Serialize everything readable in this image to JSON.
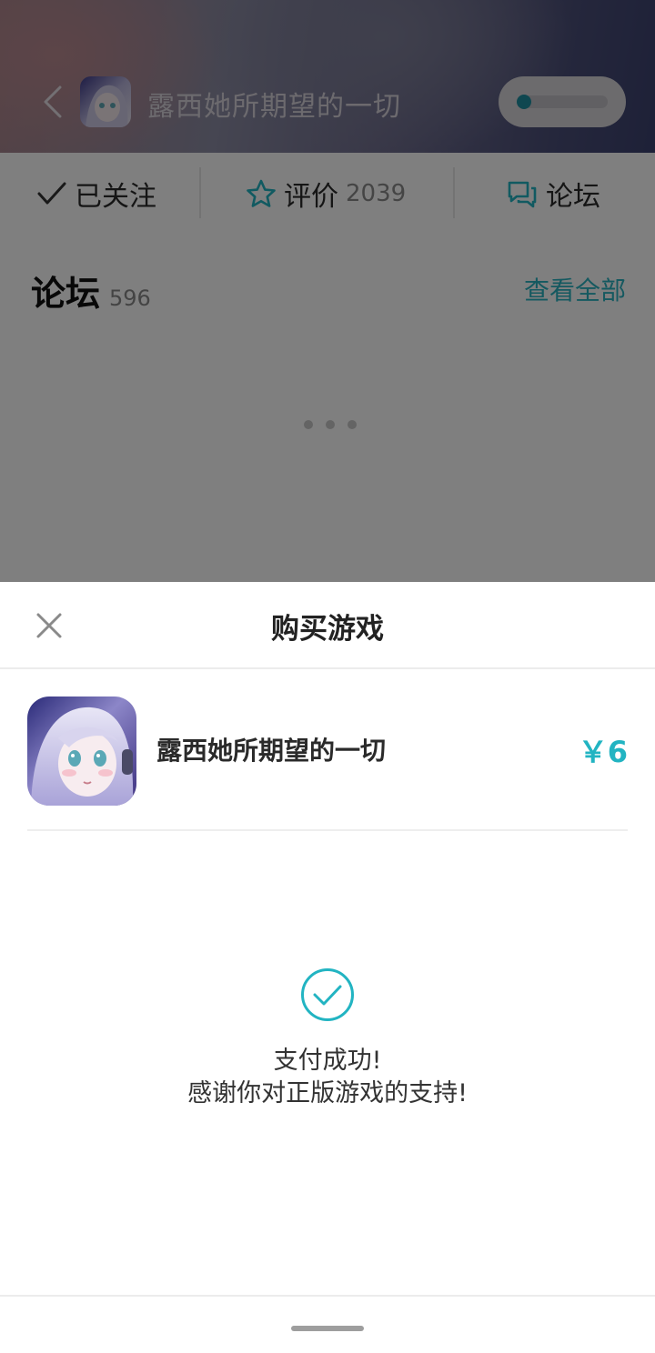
{
  "header": {
    "game_title": "露西她所期望的一切"
  },
  "tabs": {
    "follow": {
      "label": "已关注",
      "icon": "check-icon"
    },
    "rating": {
      "label": "评价",
      "count": "2039",
      "icon": "star-icon"
    },
    "forum": {
      "label": "论坛",
      "icon": "chat-bubbles-icon"
    }
  },
  "forum_section": {
    "title": "论坛",
    "count": "596",
    "view_all": "查看全部"
  },
  "purchase_sheet": {
    "title": "购买游戏",
    "game_name": "露西她所期望的一切",
    "price": "￥6",
    "success_line1": "支付成功!",
    "success_line2": "感谢你对正版游戏的支持!"
  },
  "colors": {
    "accent": "#22b4c2",
    "overlay": "rgba(0,0,0,0.5)",
    "text_primary": "#222222"
  }
}
